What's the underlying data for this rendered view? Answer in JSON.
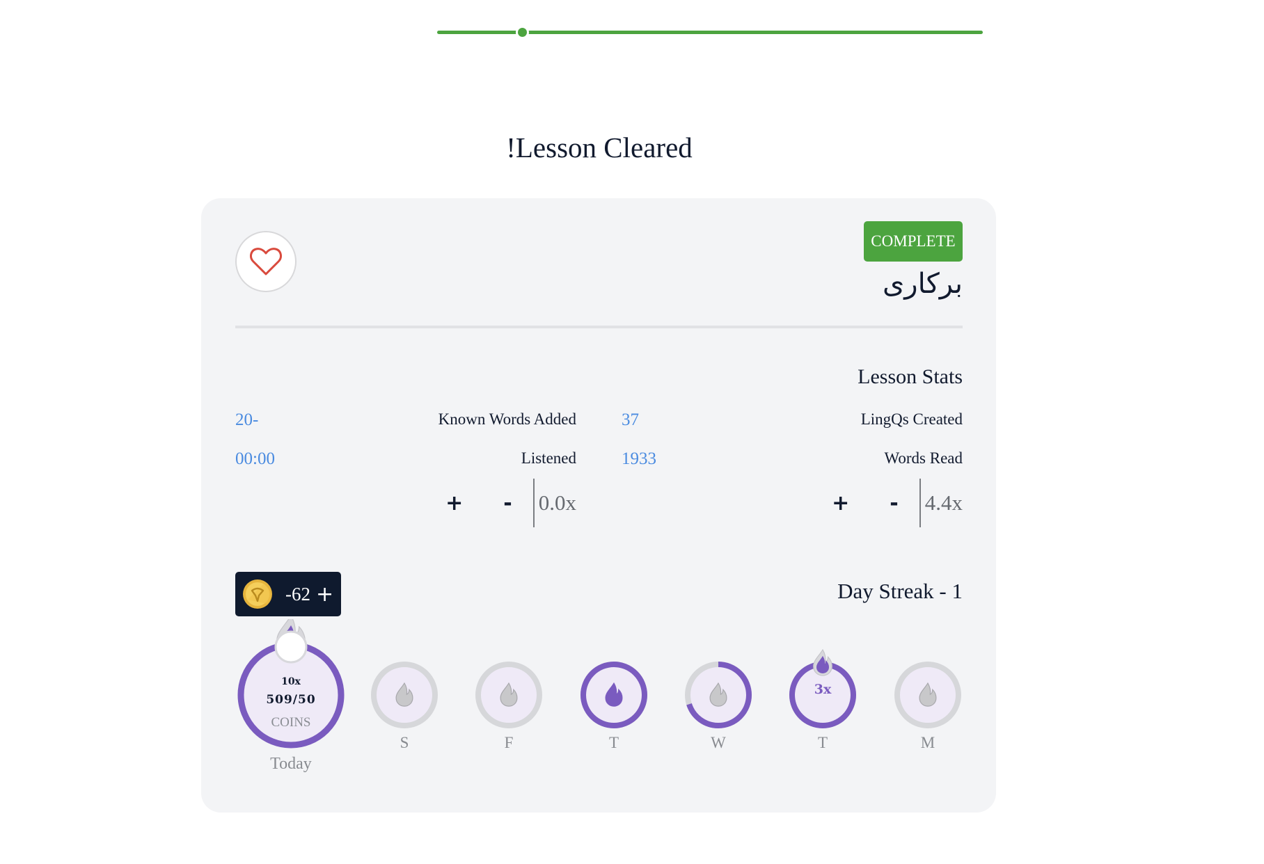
{
  "progress_slider": {
    "value_fraction": 0.156,
    "color": "#4ca43f"
  },
  "page_title": "Lesson Cleared!",
  "card": {
    "favorite_icon": "heart-outline-icon",
    "complete_button": "COMPLETE",
    "lesson_title": "برکاری",
    "stats_heading": "Lesson Stats",
    "stats": {
      "lingqs_created": {
        "label": "LingQs Created",
        "value": "37"
      },
      "known_words_added": {
        "label": "Known Words Added",
        "value": "20-"
      },
      "words_read": {
        "label": "Words Read",
        "value": "1933"
      },
      "listened": {
        "label": "Listened",
        "value": "00:00"
      }
    },
    "speed_controls": [
      {
        "name": "reading",
        "value": "4.4x",
        "plus": "+",
        "minus": "-"
      },
      {
        "name": "listening",
        "value": "0.0x",
        "plus": "+",
        "minus": "-"
      }
    ],
    "coins": {
      "value": "62-",
      "plus": "+",
      "icon": "coin-icon"
    },
    "streak_title": "Day Streak - 1",
    "today": {
      "multiplier": "10x",
      "coins_progress": "509/50",
      "coins_label": "COINS",
      "label": "Today",
      "progress": 1.0
    },
    "days": [
      {
        "label": "S",
        "progress": 0.0,
        "active": false,
        "multiplier": ""
      },
      {
        "label": "F",
        "progress": 0.0,
        "active": false,
        "multiplier": ""
      },
      {
        "label": "T",
        "progress": 1.0,
        "active": true,
        "multiplier": ""
      },
      {
        "label": "W",
        "progress": 0.7,
        "active": false,
        "multiplier": ""
      },
      {
        "label": "T",
        "progress": 1.0,
        "active": true,
        "multiplier": "3x"
      },
      {
        "label": "M",
        "progress": 0.0,
        "active": false,
        "multiplier": ""
      }
    ],
    "colors": {
      "accent_green": "#4ca43f",
      "streak_purple": "#7a5bbf",
      "value_blue": "#4a8be0",
      "ring_gray": "#d6d7da",
      "circle_fill": "#efeaf7"
    }
  }
}
